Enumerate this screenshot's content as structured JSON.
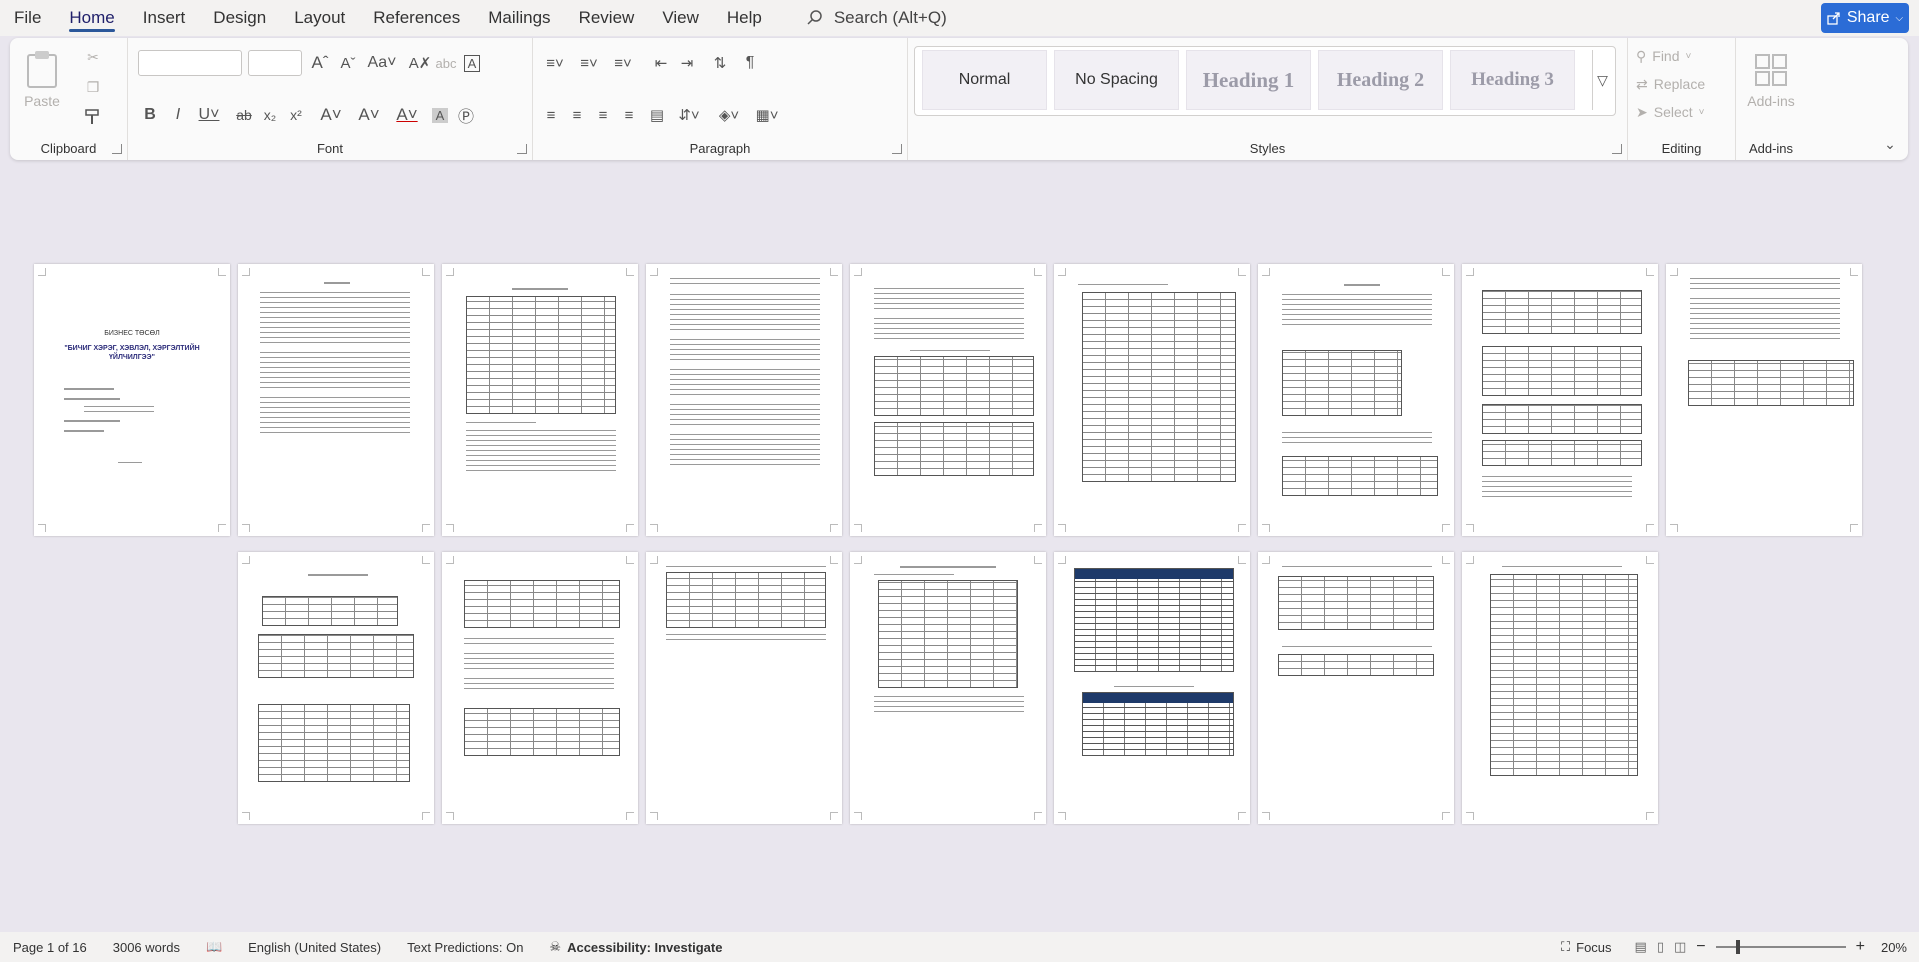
{
  "menu": {
    "tabs": [
      "File",
      "Home",
      "Insert",
      "Design",
      "Layout",
      "References",
      "Mailings",
      "Review",
      "View",
      "Help"
    ],
    "active_tab": "Home",
    "search_placeholder": "Search (Alt+Q)",
    "share_label": "Share"
  },
  "ribbon": {
    "clipboard": {
      "label": "Clipboard",
      "paste": "Paste"
    },
    "font": {
      "label": "Font"
    },
    "paragraph": {
      "label": "Paragraph"
    },
    "styles": {
      "label": "Styles",
      "items": [
        "Normal",
        "No Spacing",
        "Heading 1",
        "Heading 2",
        "Heading 3"
      ]
    },
    "editing": {
      "label": "Editing",
      "find": "Find",
      "replace": "Replace",
      "select": "Select"
    },
    "addins": {
      "label": "Add-ins",
      "button": "Add-ins"
    }
  },
  "status": {
    "page": "Page 1 of 16",
    "words": "3006 words",
    "language": "English (United States)",
    "predictions": "Text Predictions: On",
    "accessibility": "Accessibility: Investigate",
    "focus": "Focus",
    "zoom": "20%"
  },
  "document": {
    "cover_title": "БИЗНЕС ТӨСӨЛ",
    "cover_subtitle": "\"БИЧИГ ХЭРЭГ, ХЭВЛЭЛ, ХЭРГЭЛТИЙН ҮЙЛЧИЛГЭЭ\"",
    "page_count": 16
  },
  "colors": {
    "accent": "#2b579a",
    "share": "#2b6cd6",
    "canvas": "#e9e6ee"
  }
}
